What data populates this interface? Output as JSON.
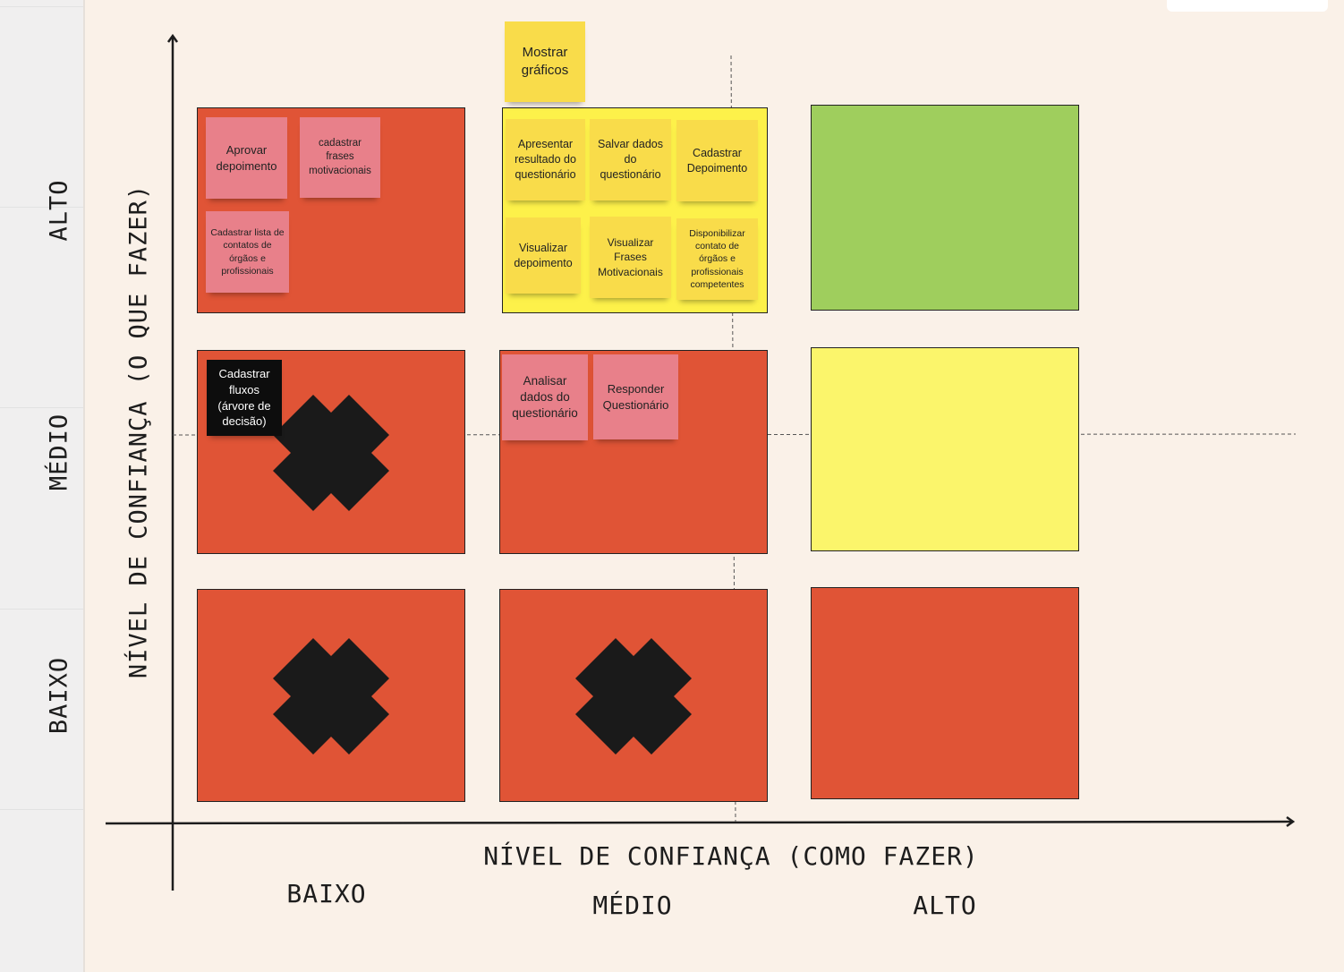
{
  "axes": {
    "y_title": "NÍVEL DE CONFIANÇA (O QUE FAZER)",
    "x_title": "NÍVEL DE CONFIANÇA (COMO FAZER)",
    "y_levels": [
      "ALTO",
      "MÉDIO",
      "BAIXO"
    ],
    "x_levels": [
      "BAIXO",
      "MÉDIO",
      "ALTO"
    ]
  },
  "floating_note": "Mostrar gráficos",
  "cells": {
    "alto_baixo": {
      "color": "#e05436",
      "notes": [
        "Aprovar depoimento",
        "cadastrar frases motivacionais",
        "Cadastrar lista de contatos de órgãos e profissionais"
      ]
    },
    "alto_medio": {
      "color": "#fdf14a",
      "notes": [
        "Apresentar resultado do questionário",
        "Salvar dados do questionário",
        "Cadastrar Depoimento",
        "Visualizar depoimento",
        "Visualizar Frases Motivacionais",
        "Disponibilizar contato de órgãos e profissionais competentes"
      ]
    },
    "alto_alto": {
      "color": "#9fce5d"
    },
    "medio_baixo": {
      "color": "#e05436",
      "notes": [
        "Cadastrar fluxos (árvore de decisão)"
      ],
      "marked": "x-icon"
    },
    "medio_medio": {
      "color": "#e05436",
      "notes": [
        "Analisar dados do questionário",
        "Responder Questionário"
      ]
    },
    "medio_alto": {
      "color": "#fbf56b"
    },
    "baixo_baixo": {
      "color": "#e05436",
      "marked": "x-icon"
    },
    "baixo_medio": {
      "color": "#e05436",
      "marked": "x-icon"
    },
    "baixo_alto": {
      "color": "#e05436"
    }
  }
}
